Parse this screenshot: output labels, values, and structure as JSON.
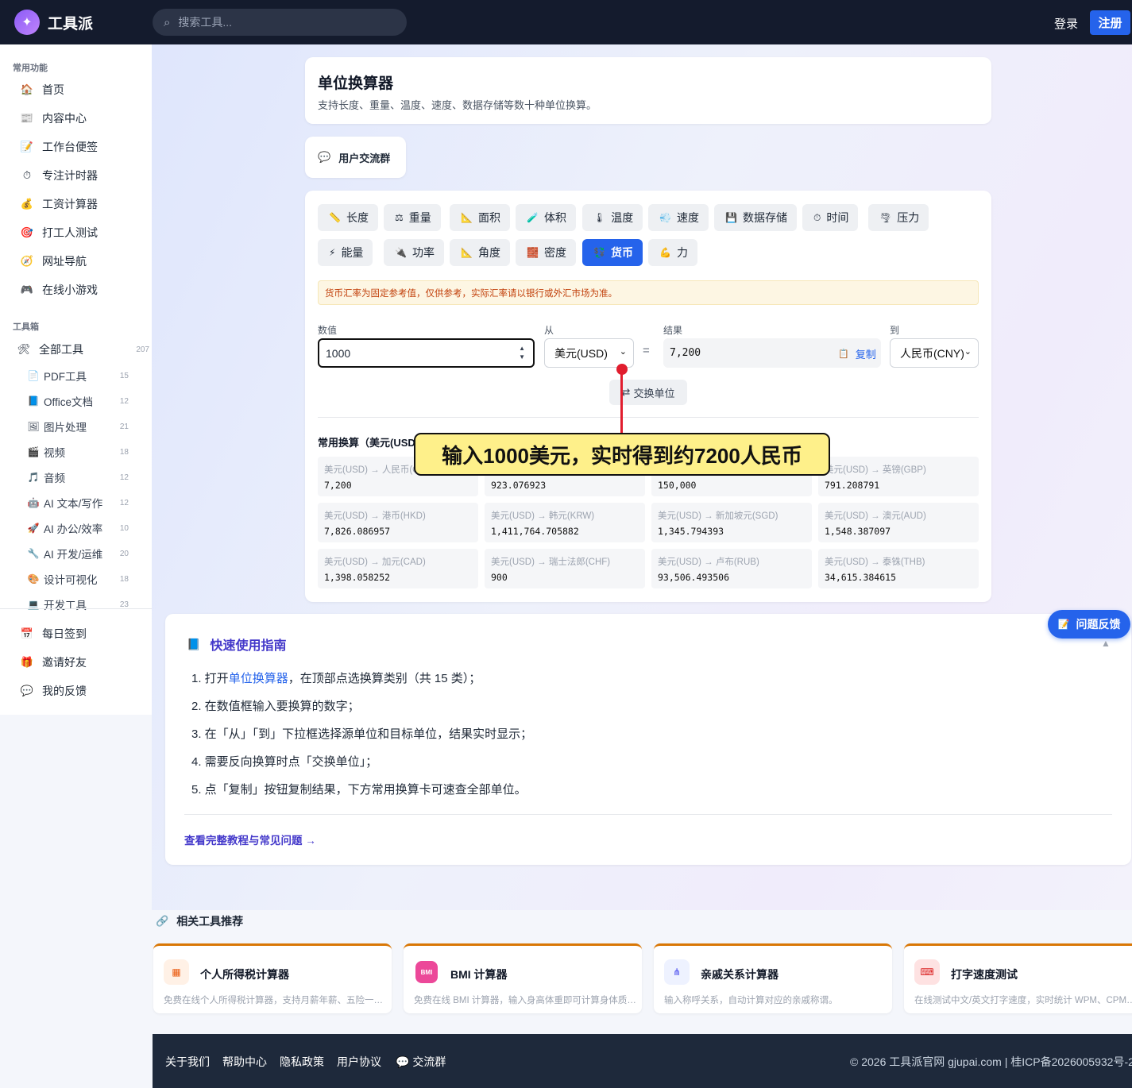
{
  "app": {
    "logo_text": "工具派",
    "search_placeholder": "搜索工具...",
    "login": "登录",
    "register": "注册"
  },
  "sidebar": {
    "section_common": "常用功能",
    "common_items": [
      {
        "icon": "🏠",
        "label": "首页"
      },
      {
        "icon": "📰",
        "label": "内容中心"
      },
      {
        "icon": "📝",
        "label": "工作台便签"
      },
      {
        "icon": "⏱",
        "label": "专注计时器"
      },
      {
        "icon": "💰",
        "label": "工资计算器"
      },
      {
        "icon": "🎯",
        "label": "打工人测试"
      },
      {
        "icon": "🧭",
        "label": "网址导航"
      },
      {
        "icon": "🎮",
        "label": "在线小游戏"
      }
    ],
    "section_tools": "工具箱",
    "all_tools": {
      "icon": "🛠",
      "label": "全部工具",
      "count": "207"
    },
    "tool_items": [
      {
        "icon": "📄",
        "label": "PDF工具",
        "count": "15"
      },
      {
        "icon": "📘",
        "label": "Office文档",
        "count": "12"
      },
      {
        "icon": "🖼",
        "label": "图片处理",
        "count": "21"
      },
      {
        "icon": "🎬",
        "label": "视频",
        "count": "18"
      },
      {
        "icon": "🎵",
        "label": "音频",
        "count": "12"
      },
      {
        "icon": "🤖",
        "label": "AI 文本/写作",
        "count": "12"
      },
      {
        "icon": "🚀",
        "label": "AI 办公/效率",
        "count": "10"
      },
      {
        "icon": "🔧",
        "label": "AI 开发/运维",
        "count": "20"
      },
      {
        "icon": "🎨",
        "label": "设计可视化",
        "count": "18"
      },
      {
        "icon": "💻",
        "label": "开发工具",
        "count": "23"
      }
    ],
    "bottom_items": [
      {
        "icon": "📅",
        "label": "每日签到"
      },
      {
        "icon": "🎁",
        "label": "邀请好友"
      },
      {
        "icon": "💬",
        "label": "我的反馈"
      }
    ]
  },
  "header_card": {
    "title": "单位换算器",
    "subtitle": "支持长度、重量、温度、速度、数据存储等数十种单位换算。"
  },
  "group_card": {
    "icon": "💬",
    "label": "用户交流群"
  },
  "categories": [
    {
      "icon": "📏",
      "label": "长度"
    },
    {
      "icon": "⚖",
      "label": "重量"
    },
    {
      "icon": "📐",
      "label": "面积"
    },
    {
      "icon": "🧪",
      "label": "体积"
    },
    {
      "icon": "🌡",
      "label": "温度"
    },
    {
      "icon": "💨",
      "label": "速度"
    },
    {
      "icon": "💾",
      "label": "数据存储"
    },
    {
      "icon": "⏱",
      "label": "时间"
    },
    {
      "icon": "🌪",
      "label": "压力"
    },
    {
      "icon": "⚡",
      "label": "能量"
    },
    {
      "icon": "🔌",
      "label": "功率"
    },
    {
      "icon": "📐",
      "label": "角度"
    },
    {
      "icon": "🧱",
      "label": "密度"
    },
    {
      "icon": "💱",
      "label": "货币"
    },
    {
      "icon": "💪",
      "label": "力"
    }
  ],
  "active_category": "货币",
  "notice": "货币汇率为固定参考值，仅供参考，实际汇率请以银行或外汇市场为准。",
  "converter": {
    "value_label": "数值",
    "value": "1000",
    "from_label": "从",
    "from_unit": "美元(USD)",
    "equals": "=",
    "result_label": "结果",
    "result": "7,200",
    "copy_label": "复制",
    "to_label": "到",
    "to_unit": "人民币(CNY)",
    "swap_label": "交换单位"
  },
  "common": {
    "title": "常用换算（美元(USD)）",
    "cells": [
      {
        "pair": "美元(USD) → 人民币(CNY)",
        "value": "7,200"
      },
      {
        "pair": "美元(USD) → 日元(JPY)",
        "value": "923.076923"
      },
      {
        "pair": "美元(USD) → 欧元(EUR)",
        "value": "150,000"
      },
      {
        "pair": "美元(USD) → 英镑(GBP)",
        "value": "791.208791"
      },
      {
        "pair": "美元(USD) → 港币(HKD)",
        "value": "7,826.086957"
      },
      {
        "pair": "美元(USD) → 韩元(KRW)",
        "value": "1,411,764.705882"
      },
      {
        "pair": "美元(USD) → 新加坡元(SGD)",
        "value": "1,345.794393"
      },
      {
        "pair": "美元(USD) → 澳元(AUD)",
        "value": "1,548.387097"
      },
      {
        "pair": "美元(USD) → 加元(CAD)",
        "value": "1,398.058252"
      },
      {
        "pair": "美元(USD) → 瑞士法郎(CHF)",
        "value": "900"
      },
      {
        "pair": "美元(USD) → 卢布(RUB)",
        "value": "93,506.493506"
      },
      {
        "pair": "美元(USD) → 泰铢(THB)",
        "value": "34,615.384615"
      }
    ]
  },
  "annotation": "输入1000美元，实时得到约7200人民币",
  "guide": {
    "title": "快速使用指南",
    "steps": [
      {
        "pre": "1. 打开",
        "link": "单位换算器",
        "post": "，在顶部点选换算类别（共 15 类）；"
      },
      {
        "pre": "2. 在数值框输入要换算的数字；",
        "link": "",
        "post": ""
      },
      {
        "pre": "3. 在「从」「到」下拉框选择源单位和目标单位，结果实时显示；",
        "link": "",
        "post": ""
      },
      {
        "pre": "4. 需要反向换算时点「交换单位」；",
        "link": "",
        "post": ""
      },
      {
        "pre": "5. 点「复制」按钮复制结果，下方常用换算卡可速查全部单位。",
        "link": "",
        "post": ""
      }
    ],
    "more": "查看完整教程与常见问题 →"
  },
  "feedback": {
    "icon": "📝",
    "label": "问题反馈"
  },
  "related": {
    "title": "相关工具推荐",
    "items": [
      {
        "icon": "▦",
        "name": "个人所得税计算器",
        "desc": "免费在线个人所得税计算器，支持月薪年薪、五险一金、专项附加扣除",
        "bg": "#fff1e6",
        "fg": "#ea580c"
      },
      {
        "icon": "BMI",
        "name": "BMI 计算器",
        "desc": "免费在线 BMI 计算器，输入身高体重即可计算身体质量指数",
        "bg": "#ec4899",
        "fg": "#ffffff"
      },
      {
        "icon": "⋔",
        "name": "亲戚关系计算器",
        "desc": "输入称呼关系，自动计算对应的亲戚称谓。",
        "bg": "#eef2ff",
        "fg": "#6366f1"
      },
      {
        "icon": "⌨",
        "name": "打字速度测试",
        "desc": "在线测试中文/英文打字速度，实时统计 WPM、CPM、准确率",
        "bg": "#fee2e2",
        "fg": "#dc2626"
      }
    ]
  },
  "footer": {
    "links": [
      "关于我们",
      "帮助中心",
      "隐私政策",
      "用户协议"
    ],
    "group": "💬 交流群",
    "copyright": "© 2026 工具派官网 gjupai.com | 桂ICP备2026005932号-2"
  }
}
